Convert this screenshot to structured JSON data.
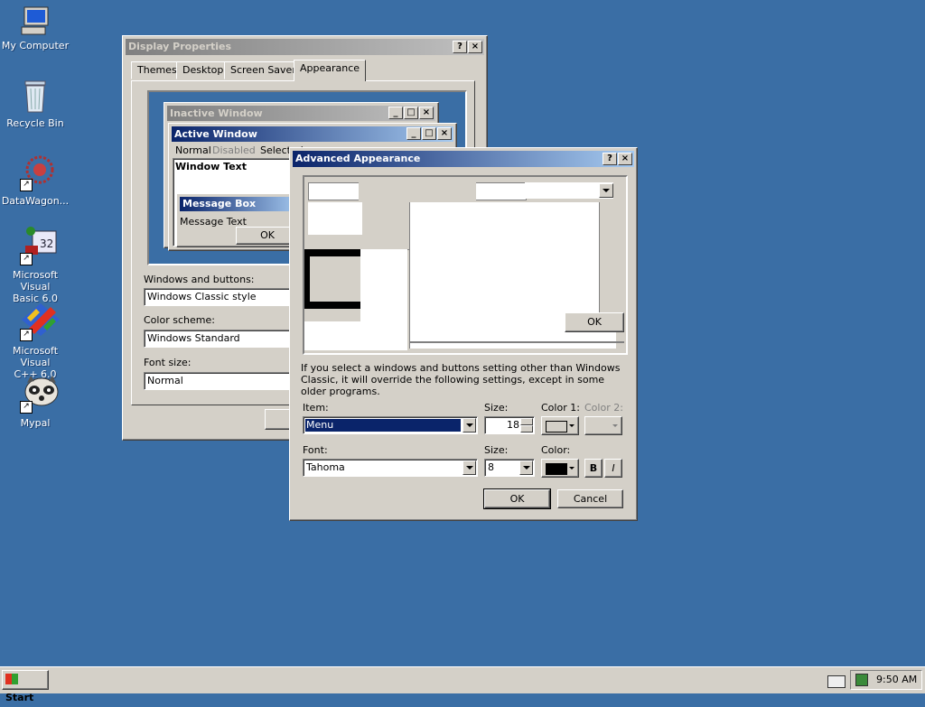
{
  "desktop": {
    "icons": [
      {
        "label1": "My Computer",
        "label2": ""
      },
      {
        "label1": "Recycle Bin",
        "label2": ""
      },
      {
        "label1": "DataWagon...",
        "label2": ""
      },
      {
        "label1": "Microsoft Visual",
        "label2": "Basic 6.0"
      },
      {
        "label1": "Microsoft Visual",
        "label2": "C++ 6.0"
      },
      {
        "label1": "Mypal",
        "label2": ""
      }
    ]
  },
  "display_properties": {
    "title": "Display Properties",
    "help": "?",
    "close": "×",
    "tabs": [
      "Themes",
      "Desktop",
      "Screen Saver",
      "Appearance"
    ],
    "preview": {
      "inactive_title": "Inactive Window",
      "active_title": "Active Window",
      "menu_normal": "Normal",
      "menu_disabled": "Disabled",
      "menu_selected": "Selected",
      "window_text": "Window Text",
      "msgbox_title": "Message Box",
      "msgbox_text": "Message Text",
      "msgbox_ok": "OK"
    },
    "windows_and_buttons_label": "Windows and buttons:",
    "windows_and_buttons_value": "Windows Classic style",
    "color_scheme_label": "Color scheme:",
    "color_scheme_value": "Windows Standard",
    "font_size_label": "Font size:",
    "font_size_value": "Normal"
  },
  "advanced": {
    "title": "Advanced Appearance",
    "help": "?",
    "close": "×",
    "preview_ok": "OK",
    "note": "If you select a windows and buttons setting other than Windows Classic, it will override the following settings, except in some older programs.",
    "item_label": "Item:",
    "item_value": "Menu",
    "size_label": "Size:",
    "item_size_value": "18",
    "color1_label": "Color 1:",
    "color2_label": "Color 2:",
    "color1_hex": "#d4d0c8",
    "font_label": "Font:",
    "font_value": "Tahoma",
    "font_size_label": "Size:",
    "font_size_value": "8",
    "font_color_label": "Color:",
    "font_color_hex": "#000000",
    "bold_label": "B",
    "italic_label": "I",
    "ok": "OK",
    "cancel": "Cancel"
  },
  "taskbar": {
    "start": "Start",
    "clock": "9:50 AM"
  }
}
